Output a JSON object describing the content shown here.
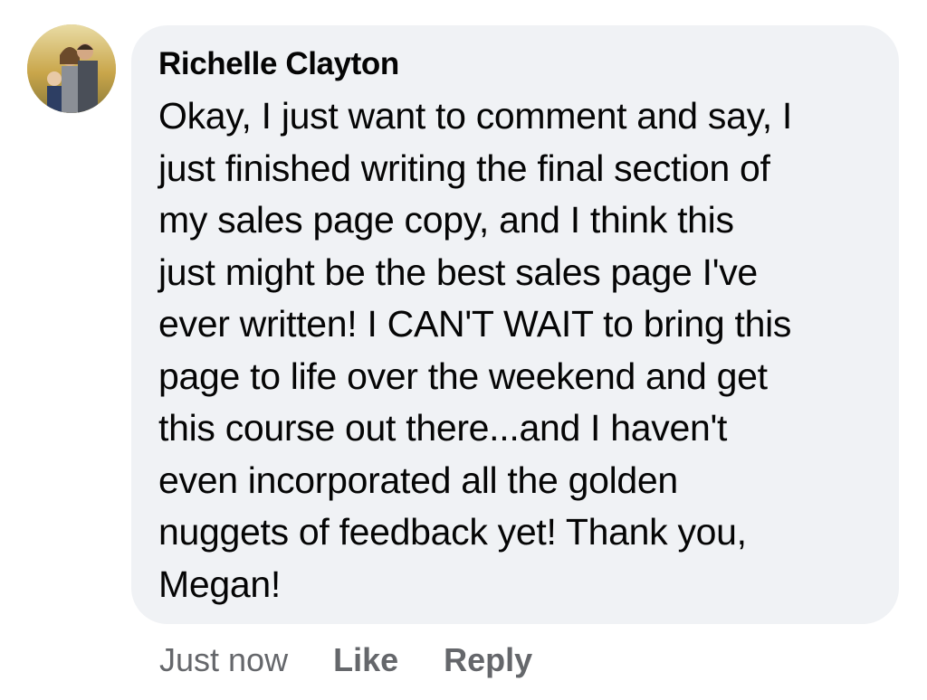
{
  "comment": {
    "author": "Richelle Clayton",
    "lines": [
      "Okay, I just want to comment and say, I",
      "just finished writing the final section of",
      "my sales page copy, and I think this",
      "just might be the best sales page I've",
      "ever written! I CAN'T WAIT to bring this",
      "page to life over the weekend and get",
      "this course out there...and I haven't",
      "even incorporated all the golden",
      "nuggets of feedback yet! Thank you,",
      "Megan!"
    ],
    "timestamp": "Just now",
    "like_label": "Like",
    "reply_label": "Reply"
  },
  "colors": {
    "bubble": "#f0f2f5",
    "text": "#050505",
    "secondary": "#65676b"
  }
}
